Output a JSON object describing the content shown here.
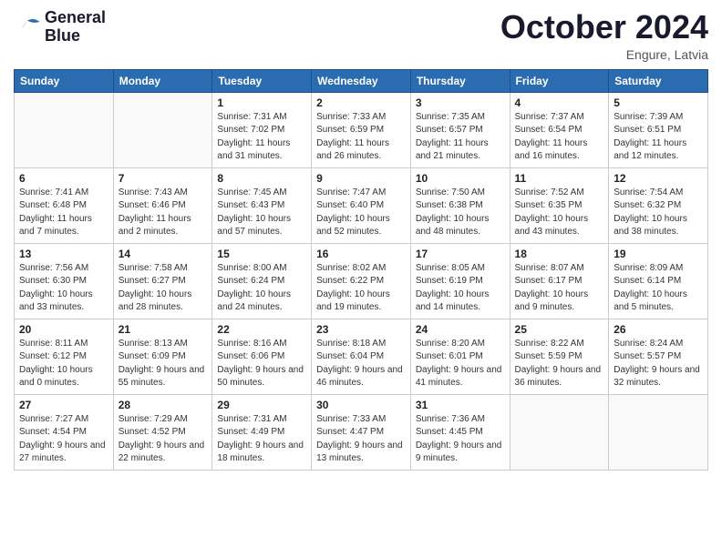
{
  "header": {
    "logo_line1": "General",
    "logo_line2": "Blue",
    "month_title": "October 2024",
    "location": "Engure, Latvia"
  },
  "weekdays": [
    "Sunday",
    "Monday",
    "Tuesday",
    "Wednesday",
    "Thursday",
    "Friday",
    "Saturday"
  ],
  "weeks": [
    [
      {
        "day": null
      },
      {
        "day": null
      },
      {
        "day": "1",
        "sunrise": "7:31 AM",
        "sunset": "7:02 PM",
        "daylight": "11 hours and 31 minutes."
      },
      {
        "day": "2",
        "sunrise": "7:33 AM",
        "sunset": "6:59 PM",
        "daylight": "11 hours and 26 minutes."
      },
      {
        "day": "3",
        "sunrise": "7:35 AM",
        "sunset": "6:57 PM",
        "daylight": "11 hours and 21 minutes."
      },
      {
        "day": "4",
        "sunrise": "7:37 AM",
        "sunset": "6:54 PM",
        "daylight": "11 hours and 16 minutes."
      },
      {
        "day": "5",
        "sunrise": "7:39 AM",
        "sunset": "6:51 PM",
        "daylight": "11 hours and 12 minutes."
      }
    ],
    [
      {
        "day": "6",
        "sunrise": "7:41 AM",
        "sunset": "6:48 PM",
        "daylight": "11 hours and 7 minutes."
      },
      {
        "day": "7",
        "sunrise": "7:43 AM",
        "sunset": "6:46 PM",
        "daylight": "11 hours and 2 minutes."
      },
      {
        "day": "8",
        "sunrise": "7:45 AM",
        "sunset": "6:43 PM",
        "daylight": "10 hours and 57 minutes."
      },
      {
        "day": "9",
        "sunrise": "7:47 AM",
        "sunset": "6:40 PM",
        "daylight": "10 hours and 52 minutes."
      },
      {
        "day": "10",
        "sunrise": "7:50 AM",
        "sunset": "6:38 PM",
        "daylight": "10 hours and 48 minutes."
      },
      {
        "day": "11",
        "sunrise": "7:52 AM",
        "sunset": "6:35 PM",
        "daylight": "10 hours and 43 minutes."
      },
      {
        "day": "12",
        "sunrise": "7:54 AM",
        "sunset": "6:32 PM",
        "daylight": "10 hours and 38 minutes."
      }
    ],
    [
      {
        "day": "13",
        "sunrise": "7:56 AM",
        "sunset": "6:30 PM",
        "daylight": "10 hours and 33 minutes."
      },
      {
        "day": "14",
        "sunrise": "7:58 AM",
        "sunset": "6:27 PM",
        "daylight": "10 hours and 28 minutes."
      },
      {
        "day": "15",
        "sunrise": "8:00 AM",
        "sunset": "6:24 PM",
        "daylight": "10 hours and 24 minutes."
      },
      {
        "day": "16",
        "sunrise": "8:02 AM",
        "sunset": "6:22 PM",
        "daylight": "10 hours and 19 minutes."
      },
      {
        "day": "17",
        "sunrise": "8:05 AM",
        "sunset": "6:19 PM",
        "daylight": "10 hours and 14 minutes."
      },
      {
        "day": "18",
        "sunrise": "8:07 AM",
        "sunset": "6:17 PM",
        "daylight": "10 hours and 9 minutes."
      },
      {
        "day": "19",
        "sunrise": "8:09 AM",
        "sunset": "6:14 PM",
        "daylight": "10 hours and 5 minutes."
      }
    ],
    [
      {
        "day": "20",
        "sunrise": "8:11 AM",
        "sunset": "6:12 PM",
        "daylight": "10 hours and 0 minutes."
      },
      {
        "day": "21",
        "sunrise": "8:13 AM",
        "sunset": "6:09 PM",
        "daylight": "9 hours and 55 minutes."
      },
      {
        "day": "22",
        "sunrise": "8:16 AM",
        "sunset": "6:06 PM",
        "daylight": "9 hours and 50 minutes."
      },
      {
        "day": "23",
        "sunrise": "8:18 AM",
        "sunset": "6:04 PM",
        "daylight": "9 hours and 46 minutes."
      },
      {
        "day": "24",
        "sunrise": "8:20 AM",
        "sunset": "6:01 PM",
        "daylight": "9 hours and 41 minutes."
      },
      {
        "day": "25",
        "sunrise": "8:22 AM",
        "sunset": "5:59 PM",
        "daylight": "9 hours and 36 minutes."
      },
      {
        "day": "26",
        "sunrise": "8:24 AM",
        "sunset": "5:57 PM",
        "daylight": "9 hours and 32 minutes."
      }
    ],
    [
      {
        "day": "27",
        "sunrise": "7:27 AM",
        "sunset": "4:54 PM",
        "daylight": "9 hours and 27 minutes."
      },
      {
        "day": "28",
        "sunrise": "7:29 AM",
        "sunset": "4:52 PM",
        "daylight": "9 hours and 22 minutes."
      },
      {
        "day": "29",
        "sunrise": "7:31 AM",
        "sunset": "4:49 PM",
        "daylight": "9 hours and 18 minutes."
      },
      {
        "day": "30",
        "sunrise": "7:33 AM",
        "sunset": "4:47 PM",
        "daylight": "9 hours and 13 minutes."
      },
      {
        "day": "31",
        "sunrise": "7:36 AM",
        "sunset": "4:45 PM",
        "daylight": "9 hours and 9 minutes."
      },
      {
        "day": null
      },
      {
        "day": null
      }
    ]
  ],
  "labels": {
    "sunrise": "Sunrise:",
    "sunset": "Sunset:",
    "daylight": "Daylight:"
  }
}
